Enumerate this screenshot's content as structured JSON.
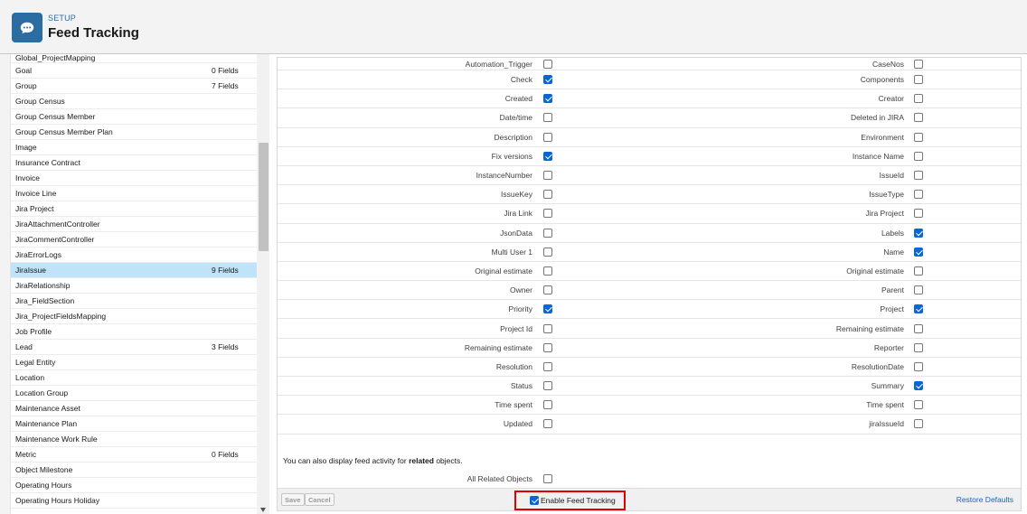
{
  "header": {
    "setup_label": "SETUP",
    "title": "Feed Tracking",
    "icon": "chat-bubble-icon",
    "accent": "#2b6ca3"
  },
  "object_list": {
    "clipped_top_item": "Global_ProjectMapping",
    "items": [
      {
        "label": "Goal",
        "fields": "0 Fields"
      },
      {
        "label": "Group",
        "fields": "7 Fields"
      },
      {
        "label": "Group Census",
        "fields": ""
      },
      {
        "label": "Group Census Member",
        "fields": ""
      },
      {
        "label": "Group Census Member Plan",
        "fields": ""
      },
      {
        "label": "Image",
        "fields": ""
      },
      {
        "label": "Insurance Contract",
        "fields": ""
      },
      {
        "label": "Invoice",
        "fields": ""
      },
      {
        "label": "Invoice Line",
        "fields": ""
      },
      {
        "label": "Jira Project",
        "fields": ""
      },
      {
        "label": "JiraAttachmentController",
        "fields": ""
      },
      {
        "label": "JiraCommentController",
        "fields": ""
      },
      {
        "label": "JiraErrorLogs",
        "fields": ""
      },
      {
        "label": "JiraIssue",
        "fields": "9 Fields",
        "selected": true
      },
      {
        "label": "JiraRelationship",
        "fields": ""
      },
      {
        "label": "Jira_FieldSection",
        "fields": ""
      },
      {
        "label": "Jira_ProjectFieldsMapping",
        "fields": ""
      },
      {
        "label": "Job Profile",
        "fields": ""
      },
      {
        "label": "Lead",
        "fields": "3 Fields"
      },
      {
        "label": "Legal Entity",
        "fields": ""
      },
      {
        "label": "Location",
        "fields": ""
      },
      {
        "label": "Location Group",
        "fields": ""
      },
      {
        "label": "Maintenance Asset",
        "fields": ""
      },
      {
        "label": "Maintenance Plan",
        "fields": ""
      },
      {
        "label": "Maintenance Work Rule",
        "fields": ""
      },
      {
        "label": "Metric",
        "fields": "0 Fields"
      },
      {
        "label": "Object Milestone",
        "fields": ""
      },
      {
        "label": "Operating Hours",
        "fields": ""
      },
      {
        "label": "Operating Hours Holiday",
        "fields": ""
      }
    ]
  },
  "field_rows": [
    {
      "left": {
        "label": "Automation_Trigger",
        "checked": false
      },
      "right": {
        "label": "CaseNos",
        "checked": false
      }
    },
    {
      "left": {
        "label": "Check",
        "checked": true
      },
      "right": {
        "label": "Components",
        "checked": false
      }
    },
    {
      "left": {
        "label": "Created",
        "checked": true
      },
      "right": {
        "label": "Creator",
        "checked": false
      }
    },
    {
      "left": {
        "label": "Date/time",
        "checked": false
      },
      "right": {
        "label": "Deleted in JIRA",
        "checked": false
      }
    },
    {
      "left": {
        "label": "Description",
        "checked": false
      },
      "right": {
        "label": "Environment",
        "checked": false
      }
    },
    {
      "left": {
        "label": "Fix versions",
        "checked": true
      },
      "right": {
        "label": "Instance Name",
        "checked": false
      }
    },
    {
      "left": {
        "label": "InstanceNumber",
        "checked": false
      },
      "right": {
        "label": "IssueId",
        "checked": false
      }
    },
    {
      "left": {
        "label": "IssueKey",
        "checked": false
      },
      "right": {
        "label": "IssueType",
        "checked": false
      }
    },
    {
      "left": {
        "label": "Jira Link",
        "checked": false
      },
      "right": {
        "label": "Jira Project",
        "checked": false
      }
    },
    {
      "left": {
        "label": "JsonData",
        "checked": false
      },
      "right": {
        "label": "Labels",
        "checked": true
      }
    },
    {
      "left": {
        "label": "Multi User 1",
        "checked": false
      },
      "right": {
        "label": "Name",
        "checked": true
      }
    },
    {
      "left": {
        "label": "Original estimate",
        "checked": false
      },
      "right": {
        "label": "Original estimate",
        "checked": false
      }
    },
    {
      "left": {
        "label": "Owner",
        "checked": false
      },
      "right": {
        "label": "Parent",
        "checked": false
      }
    },
    {
      "left": {
        "label": "Priority",
        "checked": true
      },
      "right": {
        "label": "Project",
        "checked": true
      }
    },
    {
      "left": {
        "label": "Project Id",
        "checked": false
      },
      "right": {
        "label": "Remaining estimate",
        "checked": false
      }
    },
    {
      "left": {
        "label": "Remaining estimate",
        "checked": false
      },
      "right": {
        "label": "Reporter",
        "checked": false
      }
    },
    {
      "left": {
        "label": "Resolution",
        "checked": false
      },
      "right": {
        "label": "ResolutionDate",
        "checked": false
      }
    },
    {
      "left": {
        "label": "Status",
        "checked": false
      },
      "right": {
        "label": "Summary",
        "checked": true
      }
    },
    {
      "left": {
        "label": "Time spent",
        "checked": false
      },
      "right": {
        "label": "Time spent",
        "checked": false
      }
    },
    {
      "left": {
        "label": "Updated",
        "checked": false
      },
      "right": {
        "label": "jiraIssueId",
        "checked": false
      }
    }
  ],
  "related": {
    "note_prefix": "You can also display feed activity for ",
    "note_bold": "related",
    "note_suffix": " objects.",
    "all_related_label": "All Related Objects",
    "all_related_checked": false
  },
  "footer": {
    "save_label": "Save",
    "cancel_label": "Cancel",
    "enable_label": "Enable Feed Tracking",
    "enable_checked": true,
    "restore_label": "Restore Defaults",
    "highlight_color": "#e00000"
  }
}
